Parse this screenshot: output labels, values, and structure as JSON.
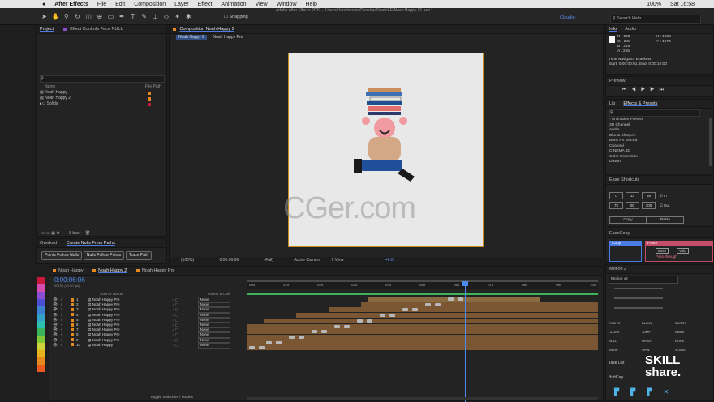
{
  "menu": {
    "app": "After Effects",
    "items": [
      "File",
      "Edit",
      "Composition",
      "Layer",
      "Effect",
      "Animation",
      "View",
      "Window",
      "Help"
    ],
    "status": "100%",
    "clock": "Sat 16:58"
  },
  "toolbar": {
    "snapping": "Snapping",
    "title": "Adobe After Effects 2020 - /Users/claudiosalas/Desktop/Noah/AE/Noah Happy 01.aep *",
    "workspace": "Claudio",
    "search": "Search Help"
  },
  "project": {
    "tab_project": "Project",
    "tab_effects": "Effect Controls Face NULL",
    "col_name": "Name",
    "col_file": "File Path",
    "items": [
      {
        "name": "Noah Happy",
        "color": "#e8891d"
      },
      {
        "name": "Noah Happy 2",
        "color": "#e8891d"
      },
      {
        "name": "Solids",
        "color": "#c8173b"
      }
    ],
    "bpc": "8 bpc"
  },
  "overlord": {
    "tab1": "Overlord",
    "tab2": "Create Nulls From Paths",
    "buttons": [
      "Points Follow Nulls",
      "Nulls Follow Points",
      "Trace Path"
    ]
  },
  "comp": {
    "tab": "Composition Noah Happy 2",
    "crumbs": [
      "Noah Happy 2",
      "Noah Happy Pre"
    ],
    "zoom": "(100%)",
    "time": "0:00:06:06",
    "res": "(Full)",
    "camera": "Active Camera",
    "view": "1 View",
    "exposure": "+0.0",
    "watermark": "CGer.com"
  },
  "info": {
    "tab_info": "Info",
    "tab_audio": "Audio",
    "r": "R : 248",
    "g": "G : 248",
    "b": "B : 248",
    "a": "A : 255",
    "x": "X : 1038",
    "y": "Y : 1074",
    "nav": "Time Navigator Brackets",
    "range": "Start: 0:00:00:01, End: 0:00:10:00"
  },
  "preview": {
    "title": "Preview"
  },
  "effects": {
    "tab_lib": "Lib",
    "tab": "Effects & Presets",
    "items": [
      "* Animation Presets",
      "3D Channel",
      "Audio",
      "Blur & Sharpen",
      "Boris FX Mocha",
      "Channel",
      "CINEMA 4D",
      "Color Correction",
      "Distort"
    ]
  },
  "ease": {
    "title": "Ease Shortcuts",
    "row1": [
      "0",
      "33",
      "66"
    ],
    "row2": [
      "75",
      "90",
      "100"
    ],
    "in_label": "In",
    "out_label": "Out",
    "copy": "Copy",
    "paste": "Paste"
  },
  "easecopy": {
    "title": "EaseCopy",
    "copy": "Copy",
    "paste": "Paste",
    "ease": "Ease",
    "value": "Valu",
    "pass": "Pass-through"
  },
  "motion": {
    "tab": "Motion 2",
    "version": "Motion v2",
    "tools": [
      "EXCITE",
      "BLEND",
      "BURST",
      "CLONE",
      "JUMP",
      "NAME",
      "NULL",
      "ORBIT",
      "ROPE",
      "WARP",
      "SPIN",
      "STARE"
    ],
    "task": "Task List",
    "buttcap": "ButtCap"
  },
  "timeline": {
    "tabs": [
      "Noah Happy",
      "Noah Happy 2",
      "Noah Happy Pre"
    ],
    "time": "0:00:06:06",
    "frames": "00150 (24.00 fps)",
    "col_source": "Source Name",
    "col_parent": "Parent & Link",
    "ruler": [
      "00s",
      "01s",
      "02s",
      "03s",
      "04s",
      "05s",
      "06s",
      "07s",
      "08s",
      "09s",
      "10s"
    ],
    "toggle": "Toggle Switches / Modes",
    "layers": [
      {
        "n": "1",
        "name": "Noah Happy Pre",
        "parent": "None"
      },
      {
        "n": "2",
        "name": "Noah Happy Pre",
        "parent": "None"
      },
      {
        "n": "3",
        "name": "Noah Happy Pre",
        "parent": "None"
      },
      {
        "n": "4",
        "name": "Noah Happy Pre",
        "parent": "None"
      },
      {
        "n": "5",
        "name": "Noah Happy Pre",
        "parent": "None"
      },
      {
        "n": "6",
        "name": "Noah Happy Pre",
        "parent": "None"
      },
      {
        "n": "7",
        "name": "Noah Happy Pre",
        "parent": "None"
      },
      {
        "n": "8",
        "name": "Noah Happy Pre",
        "parent": "None"
      },
      {
        "n": "9",
        "name": "Noah Happy Pre",
        "parent": "None"
      },
      {
        "n": "10",
        "name": "Noah Happy",
        "parent": "None"
      }
    ]
  },
  "colors": {
    "accent": "#4b7be5",
    "layer_orange": "#e8891d",
    "bar_brown": "#7a5732",
    "canvas_bg": "#e8e8e8"
  },
  "branding": {
    "skillshare": "SKILL share."
  }
}
